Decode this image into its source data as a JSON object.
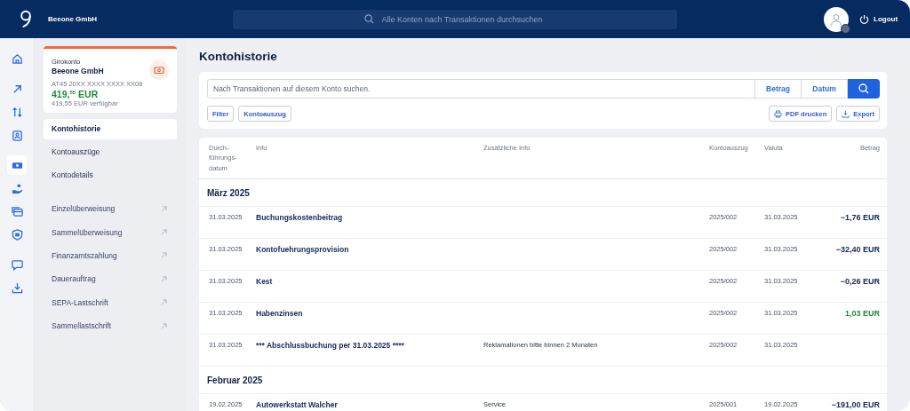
{
  "topbar": {
    "company": "Beeone GmbH",
    "search": {
      "placeholder": "Alle Konten nach Transaktionen durchsuchen"
    },
    "logout": "Logout"
  },
  "rail": [
    {
      "kind": "home",
      "selected": false
    },
    {
      "kind": "arrow",
      "selected": false
    },
    {
      "kind": "swap",
      "selected": false
    },
    {
      "kind": "badge",
      "selected": false
    },
    {
      "kind": "cash",
      "selected": true
    },
    {
      "kind": "hand",
      "selected": false
    },
    {
      "kind": "cards",
      "selected": false
    },
    {
      "kind": "shield",
      "selected": false
    },
    {
      "kind": "chat",
      "selected": false
    },
    {
      "kind": "download",
      "selected": false
    }
  ],
  "account": {
    "type": "Girokonto",
    "name": "Beeone GmbH",
    "iban": "AT45 20XX XXXX XXXX XX08",
    "balance": "419,$^{55}$ EUR",
    "available": "419,55 EUR verfügbar"
  },
  "account_nav": [
    {
      "label": "Kontohistorie",
      "selected": true
    },
    {
      "label": "Kontoauszüge",
      "selected": false
    },
    {
      "label": "Kontodetails",
      "selected": false
    }
  ],
  "actions": [
    "Einzelüberweisung",
    "Sammelüberweisung",
    "Finanzamtszahlung",
    "Dauerauftrag",
    "SEPA-Lastschrift",
    "Sammellastschrift"
  ],
  "page_title": "Kontohistorie",
  "search": {
    "placeholder": "Nach Transaktionen auf diesem Konto suchen.",
    "buttons": [
      "Betrag",
      "Datum"
    ],
    "filters": [
      "Filter",
      "Kontoauszug"
    ],
    "pdf": "PDF drucken",
    "export": "Export"
  },
  "table": {
    "columns": [
      "Durch-\nführungs-\ndatum",
      "Info",
      "Zusätzliche Info",
      "Kontoauszug",
      "Valuta",
      "Betrag"
    ],
    "groups": [
      {
        "title": "März 2025",
        "rows": [
          {
            "date": "31.03.2025",
            "info": "Buchungskostenbeitrag",
            "statement": "2025/002",
            "valuta": "31.03.2025",
            "amount": "−1,76 EUR",
            "kind": "debit"
          },
          {
            "date": "31.03.2025",
            "info": "Kontofuehrungsprovision",
            "statement": "2025/002",
            "valuta": "31.03.2025",
            "amount": "−32,40 EUR",
            "kind": "debit"
          },
          {
            "date": "31.03.2025",
            "info": "Kest",
            "statement": "2025/002",
            "valuta": "31.03.2025",
            "amount": "−0,26 EUR",
            "kind": "debit"
          },
          {
            "date": "31.03.2025",
            "info": "Habenzinsen",
            "statement": "2025/002",
            "valuta": "31.03.2025",
            "amount": "1,03 EUR",
            "kind": "credit"
          },
          {
            "date": "31.03.2025",
            "info": "*** Abschlussbuchung per 31.03.2025 ****",
            "extra": "Reklamationen bitte binnen 2 Monaten",
            "statement": "2025/002",
            "valuta": "31.03.2025"
          }
        ]
      },
      {
        "title": "Februar 2025",
        "rows": [
          {
            "date": "19.02.2025",
            "info": "Autowerkstatt Walcher",
            "extra": "Service",
            "statement": "2025/001",
            "valuta": "19.02.2025",
            "amount": "−191,00 EUR",
            "kind": "debit"
          }
        ]
      }
    ]
  }
}
